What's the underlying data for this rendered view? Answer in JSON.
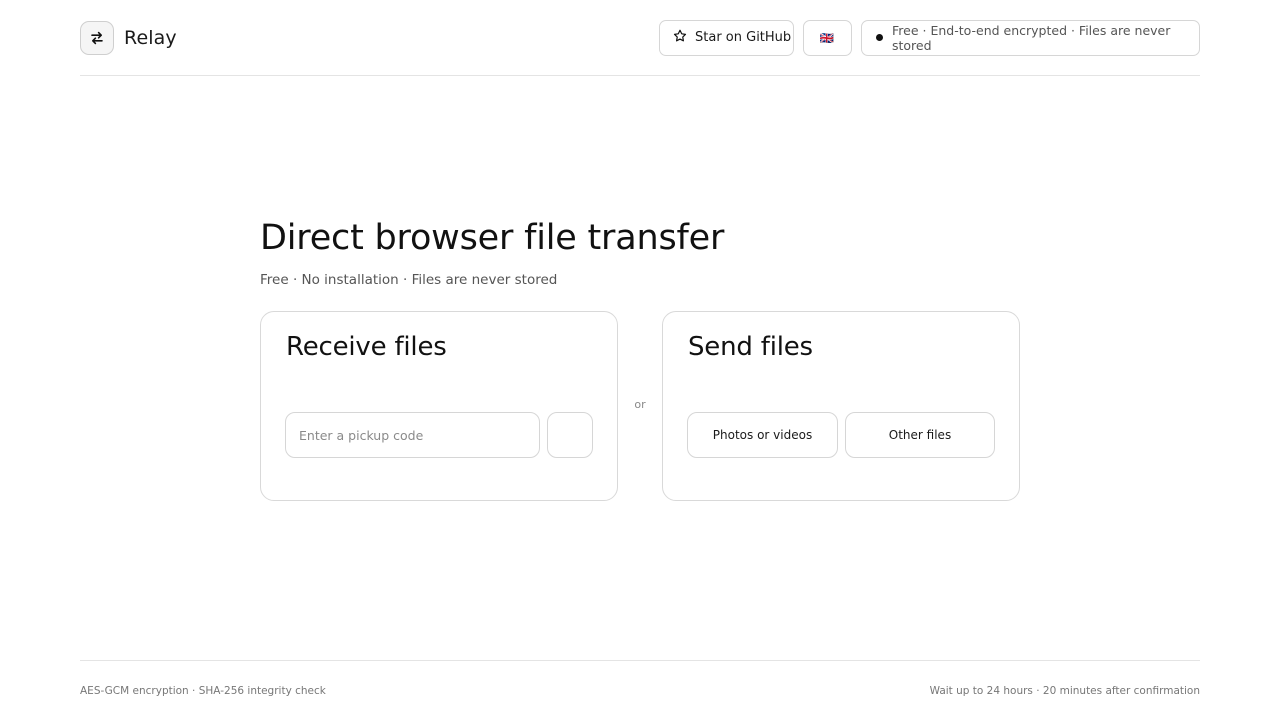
{
  "header": {
    "brand_name": "Relay",
    "logo_icon": "swap-arrows-icon",
    "star_button": {
      "icon": "star-icon",
      "label": "Star on GitHub"
    },
    "language_button": {
      "label": "🇬🇧"
    },
    "status_pill": {
      "label": "Free · End-to-end encrypted · Files are never stored"
    }
  },
  "hero": {
    "title": "Direct browser file transfer",
    "subtitle": "Free · No installation · Files are never stored"
  },
  "receive_card": {
    "title": "Receive files",
    "code_input": {
      "value": "",
      "placeholder": "Enter a pickup code"
    }
  },
  "separator_label": "or",
  "send_card": {
    "title": "Send files",
    "photos_button": "Photos or videos",
    "other_button": "Other files"
  },
  "footer": {
    "left": "AES-GCM encryption · SHA-256 integrity check",
    "right": "Wait up to 24 hours · 20 minutes after confirmation"
  }
}
